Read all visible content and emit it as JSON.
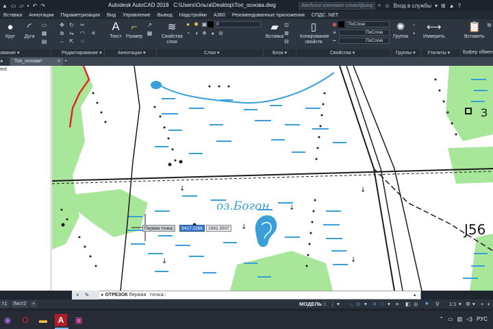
{
  "titlebar": {
    "app_title": "Autodesk AutoCAD 2018",
    "file_path": "C:\\Users\\Ольга\\Desktop\\Топ_основа.dwg",
    "search_placeholder": "Введите ключевое слово/фразу",
    "sign_in_label": "Вход в службы",
    "quick_access_icons": [
      "new-icon",
      "open-icon",
      "save-icon",
      "undo-icon",
      "redo-icon"
    ]
  },
  "menu": {
    "items": [
      "Вставка",
      "Аннотации",
      "Параметризация",
      "Вид",
      "Управление",
      "Вывод",
      "Надстройки",
      "A360",
      "Рекомендованные приложения",
      "СПДС .NET"
    ]
  },
  "ribbon": {
    "draw": {
      "circle_label": "Круг",
      "arc_label": "Дуга"
    },
    "annotation": {
      "text_label": "Текст",
      "dimension_label": "Размер"
    },
    "layers": {
      "layer_properties_label": "Свойства слоя",
      "current_layer": "0"
    },
    "block": {
      "insert_label": "Вставка"
    },
    "properties": {
      "match_label": "Копирование свойств",
      "color_value": "ПоСлою",
      "linetype_value": "ПоСлою",
      "lineweight_value": "ПоСлою"
    },
    "groups": {
      "group_label": "Группа"
    },
    "utilities": {
      "measure_label": "Измерить"
    },
    "clipboard": {
      "paste_label": "Вставить"
    }
  },
  "panels": {
    "labels": [
      "ование",
      "Редактирование",
      "Аннотации",
      "Слои",
      "Блок",
      "Свойства",
      "Группы",
      "Утилиты",
      "Буфер обмен"
    ]
  },
  "doc_tabs": {
    "file_tab": "Топ_основа*",
    "add_label": "+"
  },
  "left_panel": {
    "label": "ted"
  },
  "map": {
    "lake_label": "оз.Богон",
    "spot_height": "J56",
    "marker_label": "З"
  },
  "dynamic_input": {
    "prompt_label": "Первая точка:",
    "x_value": "3417.1268",
    "y_value": "1992.3507"
  },
  "command": {
    "command_name": "ОТРЕЗОК",
    "prompt": "Первая точка:"
  },
  "status": {
    "layout_tab_1": "т1",
    "layout_tab_2": "Лист2",
    "add_layout": "+",
    "model_label": "МОДЕЛЬ",
    "scale_label": "1:1"
  },
  "taskbar": {
    "language": "РУС",
    "apps": [
      "viber-icon",
      "opera-icon",
      "explorer-icon",
      "autocad-icon",
      "cam-icon"
    ]
  },
  "colors": {
    "ribbon_bg": "#2c3540",
    "forest_green": "#9ee48a",
    "water_blue": "#3a9fd9",
    "road_black": "#1a1a1a",
    "boundary_red": "#e0281c",
    "accent_blue": "#3a78c8"
  }
}
